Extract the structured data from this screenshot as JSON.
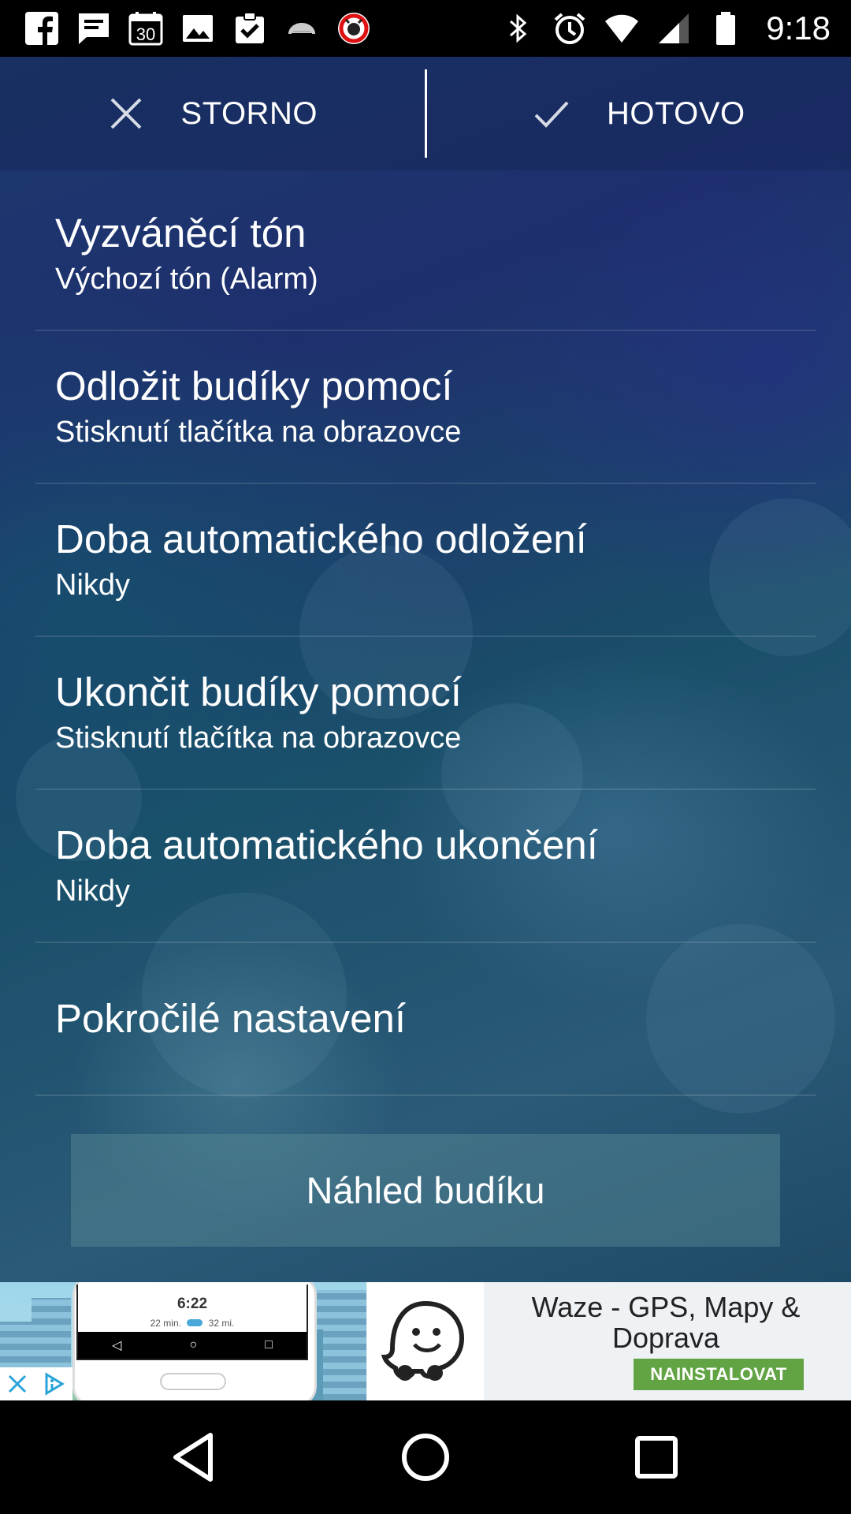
{
  "status_bar": {
    "time": "9:18",
    "notification_icons": [
      "facebook-icon",
      "messages-icon",
      "calendar-icon",
      "gallery-icon",
      "clipboard-check-icon",
      "cloud-icon",
      "alarm-app-icon"
    ],
    "calendar_day": "30",
    "system_icons": [
      "bluetooth-icon",
      "alarm-icon",
      "wifi-icon",
      "signal-icon",
      "battery-icon"
    ]
  },
  "action_bar": {
    "cancel_label": "STORNO",
    "done_label": "HOTOVO",
    "cancel_icon": "close-icon",
    "done_icon": "check-icon"
  },
  "settings": [
    {
      "title": "Vyzváněcí tón",
      "subtitle": "Výchozí tón (Alarm)"
    },
    {
      "title": "Odložit budíky pomocí",
      "subtitle": "Stisknutí tlačítka na obrazovce"
    },
    {
      "title": "Doba automatického odložení",
      "subtitle": "Nikdy"
    },
    {
      "title": "Ukončit budíky pomocí",
      "subtitle": "Stisknutí tlačítka na obrazovce"
    },
    {
      "title": "Doba automatického ukončení",
      "subtitle": "Nikdy"
    },
    {
      "title": "Pokročilé nastavení",
      "subtitle": ""
    }
  ],
  "preview_button": "Náhled budíku",
  "ad": {
    "app_title": "Waze - GPS, Mapy & Doprava",
    "install_label": "NAINSTALOVAT",
    "phone_time": "6:22",
    "phone_meta_left": "22 min.",
    "phone_meta_right": "32 mi.",
    "brand_color": "#62a343"
  },
  "nav_bar": {
    "back_icon": "back-icon",
    "home_icon": "home-icon",
    "recents_icon": "recents-icon"
  }
}
